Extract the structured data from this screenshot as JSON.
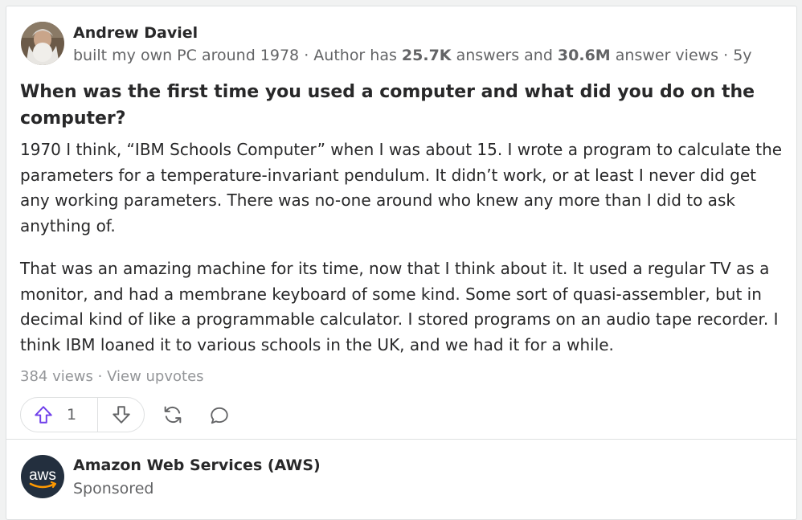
{
  "author": {
    "name": "Andrew Daviel",
    "bio": "built my own PC around 1978",
    "sep1": " · ",
    "answers_prefix": "Author has ",
    "answers_count": "25.7K",
    "answers_mid": " answers and ",
    "views_count": "30.6M",
    "views_suffix": " answer views",
    "sep2": " · ",
    "age": "5y"
  },
  "question": "When was the first time you used a computer and what did you do on the computer?",
  "answer": {
    "paragraphs": [
      "1970 I think, “IBM Schools Computer” when I was about 15. I wrote a program to calculate the parameters for a temperature-invariant pendulum. It didn’t work, or at least I never did get any working parameters. There was no-one around who knew any more than I did to ask anything of.",
      "That was an amazing machine for its time, now that I think about it. It used a regular TV as a monitor, and had a membrane keyboard of some kind. Some sort of quasi-assembler, but in decimal kind of like a programmable calculator. I stored programs on an audio tape recorder. I think IBM loaned it to various schools in the UK, and we had it for a while."
    ]
  },
  "stats": {
    "views": "384 views",
    "sep": " · ",
    "view_upvotes": "View upvotes"
  },
  "actions": {
    "upvote_count": "1",
    "upvote_color": "#6f3fea",
    "icon_color": "#636466"
  },
  "ad": {
    "name": "Amazon Web Services (AWS)",
    "label": "Sponsored",
    "logo_text": "aws"
  }
}
